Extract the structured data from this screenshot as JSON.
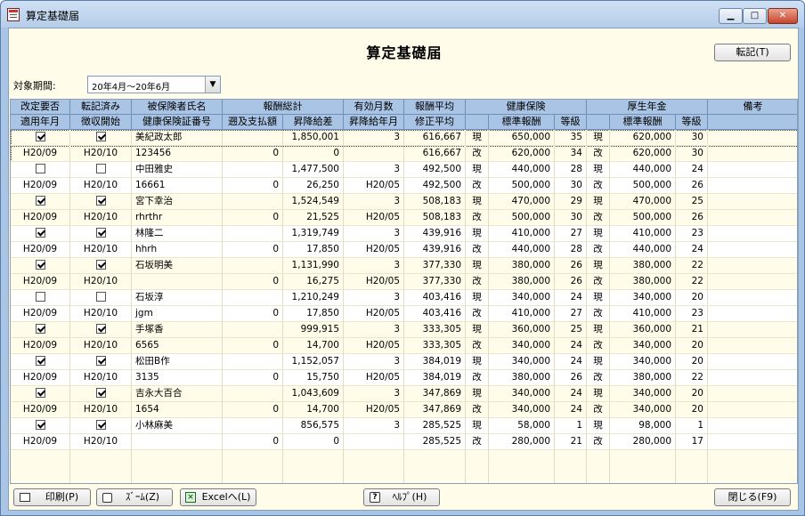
{
  "window": {
    "title": "算定基礎届"
  },
  "heading": "算定基礎届",
  "buttons": {
    "transfer": "転記(T)",
    "print": "印刷(P)",
    "zoom": "ｽﾞｰﾑ(Z)",
    "excel": "Excelへ(L)",
    "help": "ﾍﾙﾌﾟ(H)",
    "close": "閉じる(F9)"
  },
  "period": {
    "label": "対象期間:",
    "value": "20年4月～20年6月"
  },
  "header_top": [
    "改定要否",
    "転記済み",
    "被保険者氏名",
    "報酬総計",
    "有効月数",
    "報酬平均",
    "健康保険",
    "厚生年金",
    "備考"
  ],
  "header_bottom": [
    "適用年月",
    "徴収開始",
    "健康保険証番号",
    "遡及支払額",
    "昇降給差",
    "昇降給年月",
    "修正平均",
    "標準報酬",
    "等級",
    "標準報酬",
    "等級"
  ],
  "rows": [
    {
      "p": 1,
      "kaitei": "on",
      "tenki": "on",
      "name": "美紀政太郎",
      "sokyu": "",
      "total": "1,850,001",
      "months": "3",
      "heikin": "616,667",
      "hk": "現",
      "hks": "650,000",
      "hkg": "35",
      "ko": "現",
      "kos": "620,000",
      "kog": "30",
      "bikou": ""
    },
    {
      "p": 2,
      "kaitei": "H20/09",
      "tenki": "H20/10",
      "name": "123456",
      "sokyu": "0",
      "total": "0",
      "months": "",
      "heikin": "616,667",
      "hk": "改",
      "hks": "620,000",
      "hkg": "34",
      "ko": "改",
      "kos": "620,000",
      "kog": "30",
      "bikou": ""
    },
    {
      "p": 1,
      "kaitei": "off",
      "tenki": "off",
      "name": "中田雅史",
      "sokyu": "",
      "total": "1,477,500",
      "months": "3",
      "heikin": "492,500",
      "hk": "現",
      "hks": "440,000",
      "hkg": "28",
      "ko": "現",
      "kos": "440,000",
      "kog": "24",
      "bikou": ""
    },
    {
      "p": 2,
      "kaitei": "H20/09",
      "tenki": "H20/10",
      "name": "16661",
      "sokyu": "0",
      "total": "26,250",
      "months": "H20/05",
      "heikin": "492,500",
      "hk": "改",
      "hks": "500,000",
      "hkg": "30",
      "ko": "改",
      "kos": "500,000",
      "kog": "26",
      "bikou": ""
    },
    {
      "p": 1,
      "kaitei": "on",
      "tenki": "on",
      "name": "宮下幸治",
      "sokyu": "",
      "total": "1,524,549",
      "months": "3",
      "heikin": "508,183",
      "hk": "現",
      "hks": "470,000",
      "hkg": "29",
      "ko": "現",
      "kos": "470,000",
      "kog": "25",
      "bikou": ""
    },
    {
      "p": 2,
      "kaitei": "H20/09",
      "tenki": "H20/10",
      "name": "rhrthr",
      "sokyu": "0",
      "total": "21,525",
      "months": "H20/05",
      "heikin": "508,183",
      "hk": "改",
      "hks": "500,000",
      "hkg": "30",
      "ko": "改",
      "kos": "500,000",
      "kog": "26",
      "bikou": ""
    },
    {
      "p": 1,
      "kaitei": "on",
      "tenki": "on",
      "name": "林隆二",
      "sokyu": "",
      "total": "1,319,749",
      "months": "3",
      "heikin": "439,916",
      "hk": "現",
      "hks": "410,000",
      "hkg": "27",
      "ko": "現",
      "kos": "410,000",
      "kog": "23",
      "bikou": ""
    },
    {
      "p": 2,
      "kaitei": "H20/09",
      "tenki": "H20/10",
      "name": "hhrh",
      "sokyu": "0",
      "total": "17,850",
      "months": "H20/05",
      "heikin": "439,916",
      "hk": "改",
      "hks": "440,000",
      "hkg": "28",
      "ko": "改",
      "kos": "440,000",
      "kog": "24",
      "bikou": ""
    },
    {
      "p": 1,
      "kaitei": "on",
      "tenki": "on",
      "name": "石坂明美",
      "sokyu": "",
      "total": "1,131,990",
      "months": "3",
      "heikin": "377,330",
      "hk": "現",
      "hks": "380,000",
      "hkg": "26",
      "ko": "現",
      "kos": "380,000",
      "kog": "22",
      "bikou": ""
    },
    {
      "p": 2,
      "kaitei": "H20/09",
      "tenki": "H20/10",
      "name": "",
      "sokyu": "0",
      "total": "16,275",
      "months": "H20/05",
      "heikin": "377,330",
      "hk": "改",
      "hks": "380,000",
      "hkg": "26",
      "ko": "改",
      "kos": "380,000",
      "kog": "22",
      "bikou": ""
    },
    {
      "p": 1,
      "kaitei": "off",
      "tenki": "off",
      "name": "石坂淳",
      "sokyu": "",
      "total": "1,210,249",
      "months": "3",
      "heikin": "403,416",
      "hk": "現",
      "hks": "340,000",
      "hkg": "24",
      "ko": "現",
      "kos": "340,000",
      "kog": "20",
      "bikou": ""
    },
    {
      "p": 2,
      "kaitei": "H20/09",
      "tenki": "H20/10",
      "name": "jgm",
      "sokyu": "0",
      "total": "17,850",
      "months": "H20/05",
      "heikin": "403,416",
      "hk": "改",
      "hks": "410,000",
      "hkg": "27",
      "ko": "改",
      "kos": "410,000",
      "kog": "23",
      "bikou": ""
    },
    {
      "p": 1,
      "kaitei": "on",
      "tenki": "on",
      "name": "手塚香",
      "sokyu": "",
      "total": "999,915",
      "months": "3",
      "heikin": "333,305",
      "hk": "現",
      "hks": "360,000",
      "hkg": "25",
      "ko": "現",
      "kos": "360,000",
      "kog": "21",
      "bikou": ""
    },
    {
      "p": 2,
      "kaitei": "H20/09",
      "tenki": "H20/10",
      "name": "6565",
      "sokyu": "0",
      "total": "14,700",
      "months": "H20/05",
      "heikin": "333,305",
      "hk": "改",
      "hks": "340,000",
      "hkg": "24",
      "ko": "改",
      "kos": "340,000",
      "kog": "20",
      "bikou": ""
    },
    {
      "p": 1,
      "kaitei": "on",
      "tenki": "on",
      "name": "松田B作",
      "sokyu": "",
      "total": "1,152,057",
      "months": "3",
      "heikin": "384,019",
      "hk": "現",
      "hks": "340,000",
      "hkg": "24",
      "ko": "現",
      "kos": "340,000",
      "kog": "20",
      "bikou": ""
    },
    {
      "p": 2,
      "kaitei": "H20/09",
      "tenki": "H20/10",
      "name": "3135",
      "sokyu": "0",
      "total": "15,750",
      "months": "H20/05",
      "heikin": "384,019",
      "hk": "改",
      "hks": "380,000",
      "hkg": "26",
      "ko": "改",
      "kos": "380,000",
      "kog": "22",
      "bikou": ""
    },
    {
      "p": 1,
      "kaitei": "on",
      "tenki": "on",
      "name": "吉永大百合",
      "sokyu": "",
      "total": "1,043,609",
      "months": "3",
      "heikin": "347,869",
      "hk": "現",
      "hks": "340,000",
      "hkg": "24",
      "ko": "現",
      "kos": "340,000",
      "kog": "20",
      "bikou": ""
    },
    {
      "p": 2,
      "kaitei": "H20/09",
      "tenki": "H20/10",
      "name": "1654",
      "sokyu": "0",
      "total": "14,700",
      "months": "H20/05",
      "heikin": "347,869",
      "hk": "改",
      "hks": "340,000",
      "hkg": "24",
      "ko": "改",
      "kos": "340,000",
      "kog": "20",
      "bikou": ""
    },
    {
      "p": 1,
      "kaitei": "on",
      "tenki": "on",
      "name": "小林麻美",
      "sokyu": "",
      "total": "856,575",
      "months": "3",
      "heikin": "285,525",
      "hk": "現",
      "hks": "58,000",
      "hkg": "1",
      "ko": "現",
      "kos": "98,000",
      "kog": "1",
      "bikou": ""
    },
    {
      "p": 2,
      "kaitei": "H20/09",
      "tenki": "H20/10",
      "name": "",
      "sokyu": "0",
      "total": "0",
      "months": "",
      "heikin": "285,525",
      "hk": "改",
      "hks": "280,000",
      "hkg": "21",
      "ko": "改",
      "kos": "280,000",
      "kog": "17",
      "bikou": ""
    }
  ]
}
